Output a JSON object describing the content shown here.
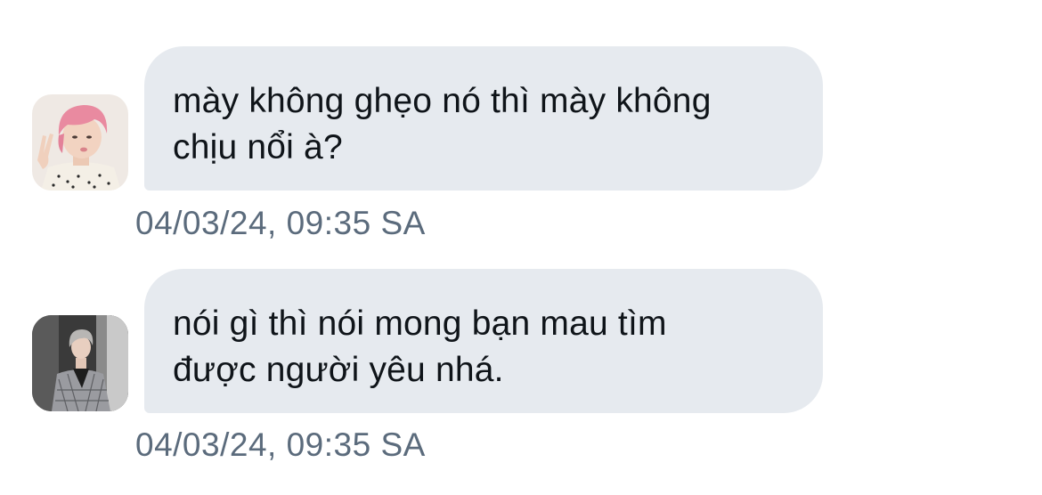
{
  "messages": [
    {
      "text": "mày không ghẹo nó thì mày không\nchịu nổi à?",
      "timestamp": "04/03/24, 09:35 SA",
      "avatar": "pink-hair-person-photo"
    },
    {
      "text": "nói gì thì nói mong bạn mau tìm\nđược người yêu nhá.",
      "timestamp": "04/03/24, 09:35 SA",
      "avatar": "gray-hair-person-photo"
    }
  ],
  "colors": {
    "bubble": "#e6eaef",
    "text": "#0f1419",
    "timestamp": "#5b6b7c"
  }
}
